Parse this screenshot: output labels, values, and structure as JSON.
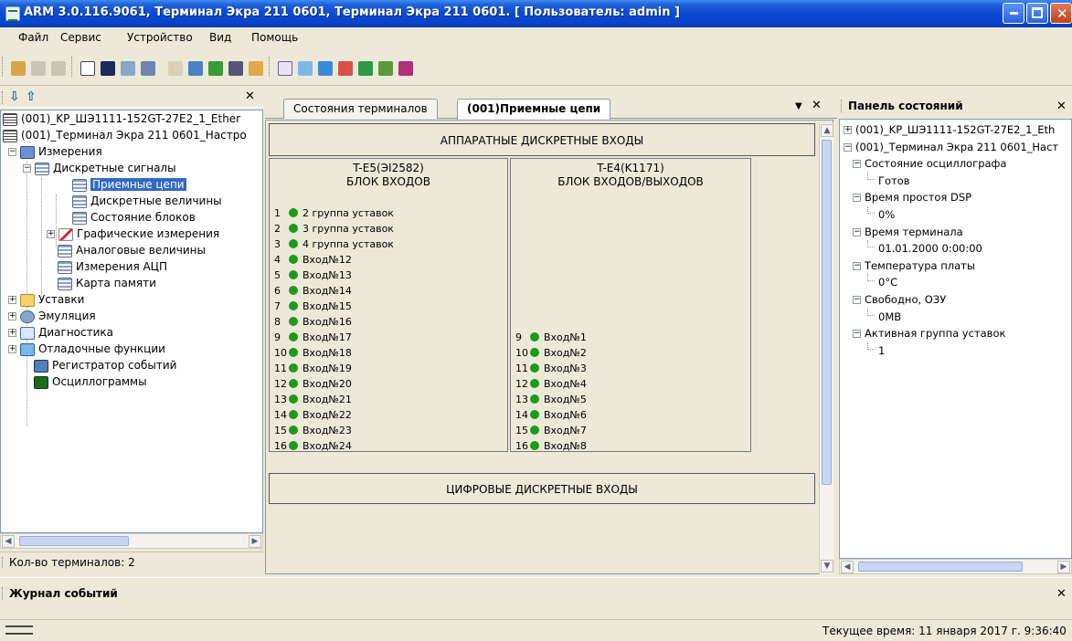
{
  "window": {
    "title": "ARM 3.0.116.9061, Терминал Экра 211 0601, Терминал Экра 211 0601. [ Пользователь: admin ]"
  },
  "menu": [
    "Файл",
    "Сервис",
    "Устройство",
    "Вид",
    "Помощь"
  ],
  "left_panel": {
    "status": "Кол-во терминалов: 2",
    "tree": [
      {
        "label": "(001)_KP_ШЭ1111-152GT-27E2_1_Ether",
        "icon": "terminal-icon"
      },
      {
        "label": "(001)_Терминал Экра 211 0601_Настро",
        "icon": "terminal-icon"
      },
      {
        "label": "Измерения",
        "icon": "measurements-icon"
      },
      {
        "label": "Дискретные сигналы",
        "icon": "grid-icon"
      },
      {
        "label": "Приемные цепи",
        "icon": "grid-icon",
        "selected": true
      },
      {
        "label": "Дискретные величины",
        "icon": "grid-icon"
      },
      {
        "label": "Состояние блоков",
        "icon": "grid-icon"
      },
      {
        "label": "Графические измерения",
        "icon": "chart-icon"
      },
      {
        "label": "Аналоговые величины",
        "icon": "grid-icon"
      },
      {
        "label": "Измерения АЦП",
        "icon": "grid-icon"
      },
      {
        "label": "Карта памяти",
        "icon": "grid-icon"
      },
      {
        "label": "Уставки",
        "icon": "folder-icon"
      },
      {
        "label": "Эмуляция",
        "icon": "gear-icon"
      },
      {
        "label": "Диагностика",
        "icon": "diagnostics-icon"
      },
      {
        "label": "Отладочные функции",
        "icon": "debug-icon"
      },
      {
        "label": "Регистратор событий",
        "icon": "book-icon"
      },
      {
        "label": "Осциллограммы",
        "icon": "oscillogram-icon"
      }
    ]
  },
  "center": {
    "tabs": [
      "Состояния терминалов",
      "(001)Приемные цепи"
    ],
    "hardware_section": "АППАРАТНЫЕ ДИСКРЕТНЫЕ ВХОДЫ",
    "digital_section": "ЦИФРОВЫЕ ДИСКРЕТНЫЕ ВХОДЫ",
    "blocks": [
      {
        "id": "T-E5(ЭI2582)",
        "name": "БЛОК ВХОДОВ",
        "inputs": [
          {
            "n": "1",
            "label": "2 группа уставок"
          },
          {
            "n": "2",
            "label": "3 группа уставок"
          },
          {
            "n": "3",
            "label": "4 группа уставок"
          },
          {
            "n": "4",
            "label": "Вход№12"
          },
          {
            "n": "5",
            "label": "Вход№13"
          },
          {
            "n": "6",
            "label": "Вход№14"
          },
          {
            "n": "7",
            "label": "Вход№15"
          },
          {
            "n": "8",
            "label": "Вход№16"
          },
          {
            "n": "9",
            "label": "Вход№17"
          },
          {
            "n": "10",
            "label": "Вход№18"
          },
          {
            "n": "11",
            "label": "Вход№19"
          },
          {
            "n": "12",
            "label": "Вход№20"
          },
          {
            "n": "13",
            "label": "Вход№21"
          },
          {
            "n": "14",
            "label": "Вход№22"
          },
          {
            "n": "15",
            "label": "Вход№23"
          },
          {
            "n": "16",
            "label": "Вход№24"
          }
        ]
      },
      {
        "id": "T-E4(K1171)",
        "name": "БЛОК ВХОДОВ/ВЫХОДОВ",
        "inputs": [
          {
            "n": "9",
            "label": "Вход№1"
          },
          {
            "n": "10",
            "label": "Вход№2"
          },
          {
            "n": "11",
            "label": "Вход№3"
          },
          {
            "n": "12",
            "label": "Вход№4"
          },
          {
            "n": "13",
            "label": "Вход№5"
          },
          {
            "n": "14",
            "label": "Вход№6"
          },
          {
            "n": "15",
            "label": "Вход№7"
          },
          {
            "n": "16",
            "label": "Вход№8"
          }
        ]
      }
    ],
    "indicator_color": "#1c9a1c"
  },
  "right_panel": {
    "title": "Панель состояний",
    "tree": [
      {
        "label": "(001)_KP_ШЭ1111-152GT-27E2_1_Eth",
        "level": 0,
        "exp": "+"
      },
      {
        "label": "(001)_Терминал Экра 211 0601_Наст",
        "level": 0,
        "exp": "-"
      },
      {
        "label": "Состояние осциллографа",
        "level": 1,
        "exp": "-"
      },
      {
        "label": "Готов",
        "level": 2
      },
      {
        "label": "Время простоя DSP",
        "level": 1,
        "exp": "-"
      },
      {
        "label": "0%",
        "level": 2
      },
      {
        "label": "Время терминала",
        "level": 1,
        "exp": "-"
      },
      {
        "label": "01.01.2000 0:00:00",
        "level": 2
      },
      {
        "label": "Температура платы",
        "level": 1,
        "exp": "-"
      },
      {
        "label": "0°C",
        "level": 2
      },
      {
        "label": "Свободно, ОЗУ",
        "level": 1,
        "exp": "-"
      },
      {
        "label": "0MB",
        "level": 2
      },
      {
        "label": "Активная группа уставок",
        "level": 1,
        "exp": "-"
      },
      {
        "label": "1",
        "level": 2
      }
    ]
  },
  "journal": {
    "title": "Журнал событий"
  },
  "statusbar": {
    "time": "Текущее время: 11 января 2017 г. 9:36:40"
  }
}
